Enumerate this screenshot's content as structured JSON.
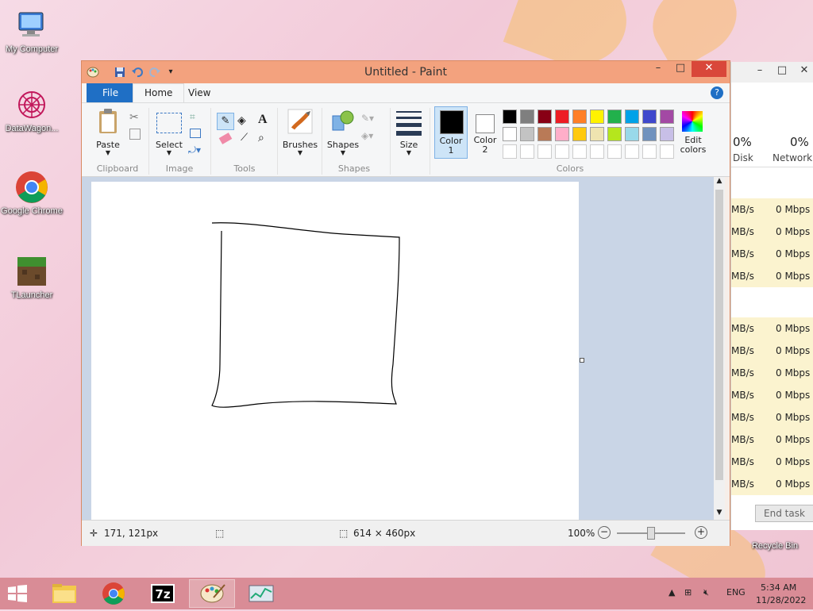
{
  "desktop": {
    "icons": [
      {
        "label": "My Computer"
      },
      {
        "label": "DataWagon..."
      },
      {
        "label": "Google Chrome"
      },
      {
        "label": "TLauncher"
      },
      {
        "label": "Recycle Bin"
      }
    ]
  },
  "taskmgr": {
    "disk_pct": "0%",
    "disk_label": "Disk",
    "net_pct": "0%",
    "net_label": "Network",
    "rows": [
      {
        "disk": "MB/s",
        "net": "0 Mbps"
      },
      {
        "disk": "MB/s",
        "net": "0 Mbps"
      },
      {
        "disk": "MB/s",
        "net": "0 Mbps"
      },
      {
        "disk": "MB/s",
        "net": "0 Mbps"
      },
      {
        "disk": "MB/s",
        "net": "0 Mbps"
      },
      {
        "disk": "MB/s",
        "net": "0 Mbps"
      },
      {
        "disk": "MB/s",
        "net": "0 Mbps"
      },
      {
        "disk": "MB/s",
        "net": "0 Mbps"
      },
      {
        "disk": "MB/s",
        "net": "0 Mbps"
      },
      {
        "disk": "MB/s",
        "net": "0 Mbps"
      },
      {
        "disk": "MB/s",
        "net": "0 Mbps"
      },
      {
        "disk": "MB/s",
        "net": "0 Mbps"
      }
    ],
    "end_task": "End task"
  },
  "paint": {
    "title": "Untitled - Paint",
    "tabs": {
      "file": "File",
      "home": "Home",
      "view": "View"
    },
    "ribbon": {
      "paste": "Paste",
      "clipboard": "Clipboard",
      "select": "Select",
      "image": "Image",
      "tools": "Tools",
      "brushes": "Brushes",
      "shapes_btn": "Shapes",
      "shapes": "Shapes",
      "size": "Size",
      "color1": "Color",
      "color1_num": "1",
      "color2": "Color",
      "color2_num": "2",
      "colors": "Colors",
      "edit_colors_1": "Edit",
      "edit_colors_2": "colors",
      "color1_value": "#000000",
      "color2_value": "#ffffff"
    },
    "palette_row1": [
      "#000000",
      "#7f7f7f",
      "#880015",
      "#ed1c24",
      "#ff7f27",
      "#fff200",
      "#22b14c",
      "#00a2e8",
      "#3f48cc",
      "#a349a4"
    ],
    "palette_row2": [
      "#ffffff",
      "#c3c3c3",
      "#b97a57",
      "#ffaec9",
      "#ffc90e",
      "#efe4b0",
      "#b5e61d",
      "#99d9ea",
      "#7092be",
      "#c8bfe7"
    ],
    "status": {
      "cursor": "171, 121px",
      "canvas_size": "614 × 460px",
      "zoom": "100%"
    }
  },
  "taskbar": {
    "lang": "ENG",
    "time": "5:34 AM",
    "date": "11/28/2022"
  }
}
